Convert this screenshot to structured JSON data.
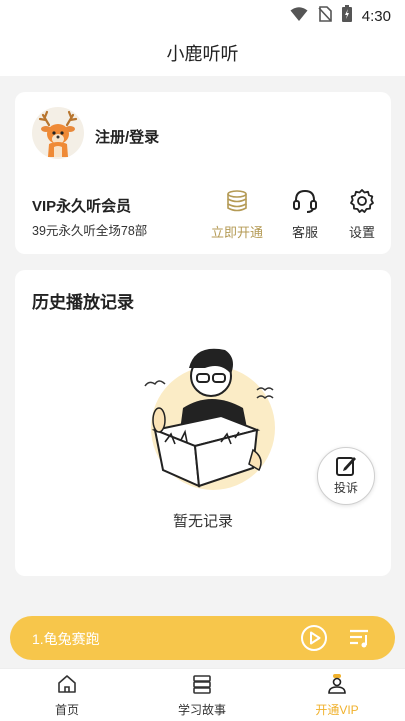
{
  "status_bar": {
    "time": "4:30",
    "icons": [
      "wifi-icon",
      "no-sim-icon",
      "battery-icon"
    ]
  },
  "app": {
    "title": "小鹿听听"
  },
  "user_card": {
    "avatar": "deer-avatar",
    "login_label": "注册/登录",
    "vip_title": "VIP永久听会员",
    "vip_subtitle": "39元永久听全场78部",
    "actions": [
      {
        "label": "立即开通",
        "icon": "coin-stack-icon",
        "color": "#b49a55"
      },
      {
        "label": "客服",
        "icon": "headset-icon"
      },
      {
        "label": "设置",
        "icon": "gear-icon"
      }
    ]
  },
  "history": {
    "title": "历史播放记录",
    "empty_text": "暂无记录"
  },
  "complaint": {
    "label": "投诉",
    "icon": "edit-icon"
  },
  "player": {
    "current_track": "1.龟兔赛跑",
    "background": "#f7c64b",
    "icons": [
      "play-icon",
      "playlist-icon"
    ]
  },
  "tabbar": {
    "active_color": "#f0b12c",
    "tabs": [
      {
        "label": "首页",
        "icon": "home-icon"
      },
      {
        "label": "学习故事",
        "icon": "books-icon"
      },
      {
        "label": "开通VIP",
        "icon": "user-icon",
        "active": true
      }
    ]
  }
}
